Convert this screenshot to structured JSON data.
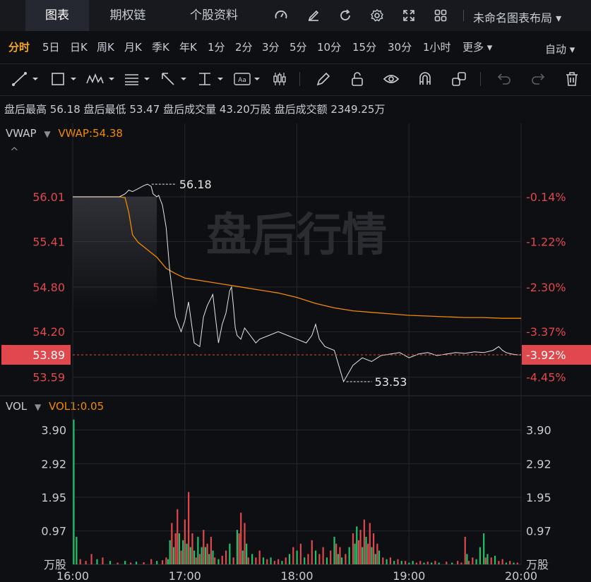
{
  "tabs": [
    {
      "label": "图表",
      "active": true
    },
    {
      "label": "期权链"
    },
    {
      "label": "个股资料"
    }
  ],
  "layout_name": "未命名图表布局",
  "periods": [
    "分时",
    "5日",
    "日K",
    "周K",
    "月K",
    "季K",
    "年K",
    "1分",
    "2分",
    "3分",
    "5分",
    "10分",
    "15分",
    "30分",
    "1小时",
    "更多 ▾"
  ],
  "period_active": "分时",
  "auto_label": "自动 ▾",
  "info": {
    "high_label": "盘后最高",
    "high": "56.18",
    "low_label": "盘后最低",
    "low": "53.47",
    "vol_label": "盘后成交量",
    "vol": "43.20万股",
    "amt_label": "盘后成交额",
    "amt": "2349.25万"
  },
  "indicator": {
    "name": "VWAP",
    "value_label": "VWAP:54.38"
  },
  "vol_indicator": {
    "name": "VOL",
    "value_label": "VOL1:0.05"
  },
  "watermark": "盘后行情",
  "colors": {
    "up": "#e0484d",
    "down": "#22c06a",
    "vwap": "#f08a00",
    "price": "#e6e6e6",
    "accent": "#f5a623",
    "bg": "#0e0f13"
  },
  "chart_data": [
    {
      "type": "line",
      "title": "",
      "price_ticks_left": [
        "56.01",
        "55.41",
        "54.80",
        "54.20",
        "53.59"
      ],
      "price_ticks_right": [
        "-0.14%",
        "-1.22%",
        "-2.30%",
        "-3.37%",
        "-4.45%"
      ],
      "current_price": "53.89",
      "current_pct": "-3.92%",
      "max_label": "56.18",
      "min_label": "53.53",
      "ylim": [
        53.35,
        56.55
      ],
      "x_ticks": [
        "16:00",
        "17:00",
        "18:00",
        "19:00",
        "20:00"
      ],
      "x_range_minutes": [
        0,
        240
      ],
      "series": [
        {
          "name": "price",
          "x": [
            0,
            5,
            10,
            15,
            20,
            25,
            28,
            30,
            32,
            35,
            38,
            40,
            42,
            43,
            45,
            46,
            48,
            50,
            52,
            55,
            58,
            60,
            62,
            65,
            68,
            70,
            72,
            75,
            78,
            80,
            82,
            84,
            85,
            86,
            87,
            88,
            90,
            92,
            95,
            98,
            100,
            105,
            110,
            115,
            120,
            125,
            128,
            130,
            132,
            135,
            140,
            145,
            150,
            155,
            160,
            165,
            170,
            175,
            180,
            185,
            190,
            195,
            200,
            205,
            210,
            215,
            220,
            225,
            228,
            230,
            232,
            235,
            238,
            240
          ],
          "y": [
            56.01,
            56.01,
            56.01,
            56.01,
            56.01,
            56.01,
            56.05,
            56.1,
            56.08,
            56.12,
            56.16,
            56.18,
            56.15,
            56.05,
            56.01,
            56.03,
            55.9,
            55.6,
            55.0,
            54.4,
            54.2,
            54.35,
            54.6,
            54.05,
            54.0,
            54.4,
            54.55,
            54.7,
            54.05,
            54.3,
            54.45,
            54.75,
            54.8,
            54.55,
            54.25,
            54.15,
            54.1,
            54.25,
            54.15,
            54.05,
            54.1,
            54.15,
            54.2,
            54.15,
            54.1,
            54.05,
            54.15,
            54.3,
            54.1,
            54.0,
            53.95,
            53.53,
            53.75,
            53.85,
            53.8,
            53.88,
            53.9,
            53.92,
            53.85,
            53.9,
            53.92,
            53.88,
            53.9,
            53.92,
            53.91,
            53.93,
            53.92,
            53.95,
            54.0,
            53.95,
            53.92,
            53.9,
            53.89,
            53.89
          ]
        },
        {
          "name": "VWAP",
          "x": [
            0,
            10,
            20,
            25,
            28,
            30,
            32,
            35,
            40,
            45,
            50,
            55,
            60,
            70,
            80,
            90,
            100,
            110,
            120,
            130,
            140,
            150,
            160,
            170,
            180,
            190,
            200,
            210,
            220,
            230,
            240
          ],
          "y": [
            56.01,
            56.01,
            56.01,
            56.01,
            56.0,
            55.8,
            55.5,
            55.4,
            55.3,
            55.2,
            55.05,
            54.98,
            54.92,
            54.88,
            54.84,
            54.8,
            54.76,
            54.72,
            54.66,
            54.58,
            54.52,
            54.48,
            54.46,
            54.44,
            54.42,
            54.41,
            54.4,
            54.39,
            54.39,
            54.38,
            54.38
          ]
        }
      ]
    },
    {
      "type": "bar",
      "ylabel": "万股",
      "vol_ticks": [
        "3.90",
        "2.92",
        "1.95",
        "0.97"
      ],
      "ylim": [
        0,
        4.3
      ],
      "x_range_minutes": [
        0,
        240
      ],
      "bars": [
        {
          "x": 0.5,
          "v": 4.2,
          "c": "down"
        },
        {
          "x": 2,
          "v": 0.8,
          "c": "down"
        },
        {
          "x": 4,
          "v": 0.15,
          "c": "up"
        },
        {
          "x": 7,
          "v": 0.1,
          "c": "up"
        },
        {
          "x": 10,
          "v": 0.3,
          "c": "up"
        },
        {
          "x": 13,
          "v": 0.15,
          "c": "down"
        },
        {
          "x": 16,
          "v": 0.2,
          "c": "up"
        },
        {
          "x": 20,
          "v": 0.1,
          "c": "down"
        },
        {
          "x": 24,
          "v": 0.05,
          "c": "up"
        },
        {
          "x": 28,
          "v": 0.1,
          "c": "down"
        },
        {
          "x": 31,
          "v": 0.05,
          "c": "up"
        },
        {
          "x": 34,
          "v": 0.08,
          "c": "down"
        },
        {
          "x": 38,
          "v": 0.06,
          "c": "up"
        },
        {
          "x": 42,
          "v": 0.15,
          "c": "up"
        },
        {
          "x": 45,
          "v": 0.1,
          "c": "down"
        },
        {
          "x": 48,
          "v": 0.12,
          "c": "up"
        },
        {
          "x": 50,
          "v": 0.2,
          "c": "up"
        },
        {
          "x": 51,
          "v": 0.15,
          "c": "down"
        },
        {
          "x": 52,
          "v": 0.7,
          "c": "down"
        },
        {
          "x": 53,
          "v": 1.2,
          "c": "up"
        },
        {
          "x": 54,
          "v": 0.5,
          "c": "down"
        },
        {
          "x": 55,
          "v": 0.9,
          "c": "up"
        },
        {
          "x": 56,
          "v": 1.6,
          "c": "up"
        },
        {
          "x": 57,
          "v": 0.9,
          "c": "down"
        },
        {
          "x": 58,
          "v": 0.4,
          "c": "up"
        },
        {
          "x": 59,
          "v": 0.7,
          "c": "down"
        },
        {
          "x": 60,
          "v": 1.3,
          "c": "up"
        },
        {
          "x": 61,
          "v": 0.6,
          "c": "down"
        },
        {
          "x": 62,
          "v": 2.1,
          "c": "up"
        },
        {
          "x": 63,
          "v": 0.5,
          "c": "down"
        },
        {
          "x": 64,
          "v": 0.9,
          "c": "up"
        },
        {
          "x": 65,
          "v": 0.4,
          "c": "down"
        },
        {
          "x": 66,
          "v": 0.2,
          "c": "up"
        },
        {
          "x": 67,
          "v": 0.8,
          "c": "down"
        },
        {
          "x": 68,
          "v": 0.3,
          "c": "up"
        },
        {
          "x": 69,
          "v": 0.5,
          "c": "down"
        },
        {
          "x": 70,
          "v": 1.0,
          "c": "up"
        },
        {
          "x": 71,
          "v": 0.5,
          "c": "down"
        },
        {
          "x": 72,
          "v": 0.6,
          "c": "up"
        },
        {
          "x": 73,
          "v": 0.3,
          "c": "down"
        },
        {
          "x": 74,
          "v": 0.8,
          "c": "up"
        },
        {
          "x": 75,
          "v": 0.4,
          "c": "down"
        },
        {
          "x": 76,
          "v": 0.2,
          "c": "up"
        },
        {
          "x": 78,
          "v": 0.15,
          "c": "down"
        },
        {
          "x": 80,
          "v": 0.25,
          "c": "up"
        },
        {
          "x": 82,
          "v": 0.4,
          "c": "up"
        },
        {
          "x": 84,
          "v": 0.6,
          "c": "down"
        },
        {
          "x": 86,
          "v": 0.2,
          "c": "up"
        },
        {
          "x": 88,
          "v": 1.0,
          "c": "down"
        },
        {
          "x": 89,
          "v": 0.9,
          "c": "up"
        },
        {
          "x": 90,
          "v": 1.5,
          "c": "up"
        },
        {
          "x": 91,
          "v": 0.4,
          "c": "down"
        },
        {
          "x": 92,
          "v": 1.2,
          "c": "up"
        },
        {
          "x": 93,
          "v": 0.6,
          "c": "down"
        },
        {
          "x": 94,
          "v": 0.2,
          "c": "up"
        },
        {
          "x": 96,
          "v": 0.3,
          "c": "down"
        },
        {
          "x": 98,
          "v": 0.2,
          "c": "up"
        },
        {
          "x": 100,
          "v": 0.4,
          "c": "up"
        },
        {
          "x": 102,
          "v": 0.2,
          "c": "down"
        },
        {
          "x": 104,
          "v": 0.15,
          "c": "up"
        },
        {
          "x": 106,
          "v": 0.2,
          "c": "down"
        },
        {
          "x": 108,
          "v": 0.1,
          "c": "up"
        },
        {
          "x": 110,
          "v": 0.15,
          "c": "up"
        },
        {
          "x": 112,
          "v": 0.1,
          "c": "down"
        },
        {
          "x": 114,
          "v": 0.2,
          "c": "up"
        },
        {
          "x": 116,
          "v": 0.3,
          "c": "down"
        },
        {
          "x": 118,
          "v": 0.5,
          "c": "up"
        },
        {
          "x": 120,
          "v": 0.4,
          "c": "down"
        },
        {
          "x": 122,
          "v": 0.6,
          "c": "up"
        },
        {
          "x": 124,
          "v": 0.2,
          "c": "down"
        },
        {
          "x": 126,
          "v": 0.3,
          "c": "up"
        },
        {
          "x": 128,
          "v": 0.7,
          "c": "up"
        },
        {
          "x": 130,
          "v": 0.4,
          "c": "down"
        },
        {
          "x": 132,
          "v": 0.3,
          "c": "up"
        },
        {
          "x": 134,
          "v": 0.5,
          "c": "up"
        },
        {
          "x": 136,
          "v": 0.2,
          "c": "down"
        },
        {
          "x": 138,
          "v": 0.4,
          "c": "up"
        },
        {
          "x": 140,
          "v": 0.8,
          "c": "down"
        },
        {
          "x": 141,
          "v": 0.6,
          "c": "up"
        },
        {
          "x": 142,
          "v": 0.3,
          "c": "down"
        },
        {
          "x": 143,
          "v": 0.5,
          "c": "up"
        },
        {
          "x": 144,
          "v": 0.2,
          "c": "down"
        },
        {
          "x": 146,
          "v": 0.3,
          "c": "up"
        },
        {
          "x": 148,
          "v": 0.5,
          "c": "down"
        },
        {
          "x": 150,
          "v": 0.9,
          "c": "up"
        },
        {
          "x": 151,
          "v": 0.6,
          "c": "down"
        },
        {
          "x": 152,
          "v": 1.1,
          "c": "down"
        },
        {
          "x": 153,
          "v": 0.7,
          "c": "up"
        },
        {
          "x": 154,
          "v": 1.0,
          "c": "up"
        },
        {
          "x": 155,
          "v": 0.5,
          "c": "down"
        },
        {
          "x": 156,
          "v": 1.3,
          "c": "up"
        },
        {
          "x": 157,
          "v": 0.8,
          "c": "down"
        },
        {
          "x": 158,
          "v": 0.6,
          "c": "up"
        },
        {
          "x": 159,
          "v": 1.2,
          "c": "up"
        },
        {
          "x": 160,
          "v": 0.5,
          "c": "down"
        },
        {
          "x": 161,
          "v": 0.9,
          "c": "up"
        },
        {
          "x": 162,
          "v": 0.3,
          "c": "down"
        },
        {
          "x": 163,
          "v": 0.6,
          "c": "up"
        },
        {
          "x": 164,
          "v": 0.4,
          "c": "down"
        },
        {
          "x": 166,
          "v": 0.2,
          "c": "up"
        },
        {
          "x": 168,
          "v": 0.15,
          "c": "down"
        },
        {
          "x": 170,
          "v": 0.2,
          "c": "up"
        },
        {
          "x": 172,
          "v": 0.1,
          "c": "down"
        },
        {
          "x": 174,
          "v": 0.15,
          "c": "up"
        },
        {
          "x": 176,
          "v": 0.1,
          "c": "down"
        },
        {
          "x": 178,
          "v": 0.1,
          "c": "up"
        },
        {
          "x": 180,
          "v": 0.05,
          "c": "down"
        },
        {
          "x": 182,
          "v": 0.1,
          "c": "down"
        },
        {
          "x": 184,
          "v": 0.05,
          "c": "up"
        },
        {
          "x": 186,
          "v": 0.1,
          "c": "up"
        },
        {
          "x": 188,
          "v": 0.05,
          "c": "down"
        },
        {
          "x": 190,
          "v": 0.08,
          "c": "up"
        },
        {
          "x": 192,
          "v": 0.05,
          "c": "down"
        },
        {
          "x": 194,
          "v": 0.1,
          "c": "up"
        },
        {
          "x": 196,
          "v": 0.05,
          "c": "down"
        },
        {
          "x": 200,
          "v": 0.08,
          "c": "up"
        },
        {
          "x": 203,
          "v": 0.05,
          "c": "down"
        },
        {
          "x": 206,
          "v": 0.1,
          "c": "up"
        },
        {
          "x": 208,
          "v": 0.05,
          "c": "up"
        },
        {
          "x": 210,
          "v": 0.8,
          "c": "up"
        },
        {
          "x": 211,
          "v": 0.3,
          "c": "down"
        },
        {
          "x": 212,
          "v": 0.1,
          "c": "up"
        },
        {
          "x": 214,
          "v": 0.2,
          "c": "up"
        },
        {
          "x": 216,
          "v": 0.15,
          "c": "down"
        },
        {
          "x": 218,
          "v": 0.5,
          "c": "down"
        },
        {
          "x": 220,
          "v": 0.9,
          "c": "down"
        },
        {
          "x": 221,
          "v": 0.2,
          "c": "up"
        },
        {
          "x": 222,
          "v": 0.3,
          "c": "down"
        },
        {
          "x": 224,
          "v": 0.2,
          "c": "up"
        },
        {
          "x": 226,
          "v": 0.25,
          "c": "down"
        },
        {
          "x": 228,
          "v": 0.1,
          "c": "up"
        },
        {
          "x": 230,
          "v": 0.15,
          "c": "up"
        },
        {
          "x": 232,
          "v": 0.05,
          "c": "down"
        },
        {
          "x": 234,
          "v": 0.1,
          "c": "up"
        },
        {
          "x": 236,
          "v": 0.05,
          "c": "down"
        },
        {
          "x": 238,
          "v": 0.05,
          "c": "up"
        }
      ]
    }
  ]
}
